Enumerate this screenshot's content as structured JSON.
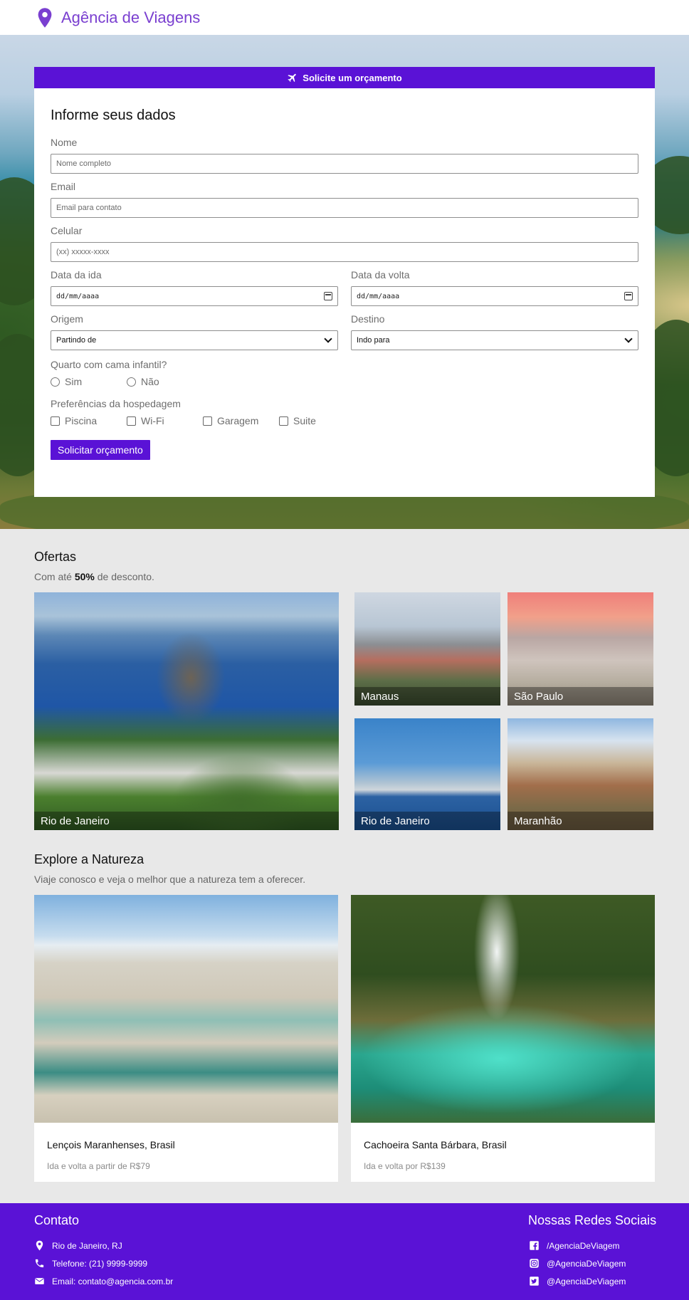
{
  "navbar": {
    "brand": "Agência de Viagens"
  },
  "form": {
    "header": "Solicite um orçamento",
    "title": "Informe seus dados",
    "nome_label": "Nome",
    "nome_placeholder": "Nome completo",
    "email_label": "Email",
    "email_placeholder": "Email para contato",
    "celular_label": "Celular",
    "celular_placeholder": "(xx) xxxxx-xxxx",
    "ida_label": "Data da ida",
    "ida_value": "dd/mm/aaaa",
    "volta_label": "Data da volta",
    "volta_value": "dd/mm/aaaa",
    "origem_label": "Origem",
    "origem_value": "Partindo de",
    "destino_label": "Destino",
    "destino_value": "Indo para",
    "cama_label": "Quarto com cama infantil?",
    "cama_options": [
      "Sim",
      "Não"
    ],
    "pref_label": "Preferências da hospedagem",
    "pref_options": [
      "Piscina",
      "Wi-Fi",
      "Garagem",
      "Suite"
    ],
    "submit": "Solicitar orçamento"
  },
  "ofertas": {
    "title": "Ofertas",
    "sub_prefix": "Com até ",
    "sub_bold": "50%",
    "sub_suffix": " de desconto.",
    "tiles": [
      "Rio de Janeiro",
      "Manaus",
      "São Paulo",
      "Rio de Janeiro",
      "Maranhão"
    ]
  },
  "natureza": {
    "title": "Explore a Natureza",
    "sub": "Viaje conosco e veja o melhor que a natureza tem a oferecer.",
    "cards": [
      {
        "title": "Lençois Maranhenses, Brasil",
        "desc": "Ida e volta a partir de R$79"
      },
      {
        "title": "Cachoeira Santa Bárbara, Brasil",
        "desc": "Ida e volta por R$139"
      }
    ]
  },
  "footer": {
    "contato_title": "Contato",
    "location": "Rio de Janeiro, RJ",
    "phone": "Telefone: (21) 9999-9999",
    "email": "Email: contato@agencia.com.br",
    "social_title": "Nossas Redes Sociais",
    "facebook": "/AgenciaDeViagem",
    "instagram": "@AgenciaDeViagem",
    "twitter": "@AgenciaDeViagem"
  },
  "colors": {
    "accent": "#5a12d6",
    "brand": "#7a3fd0"
  },
  "icons": [
    "map-pin-icon",
    "plane-icon",
    "calendar-icon",
    "chevron-down-icon",
    "phone-icon",
    "envelope-icon",
    "facebook-icon",
    "instagram-icon",
    "twitter-icon"
  ]
}
